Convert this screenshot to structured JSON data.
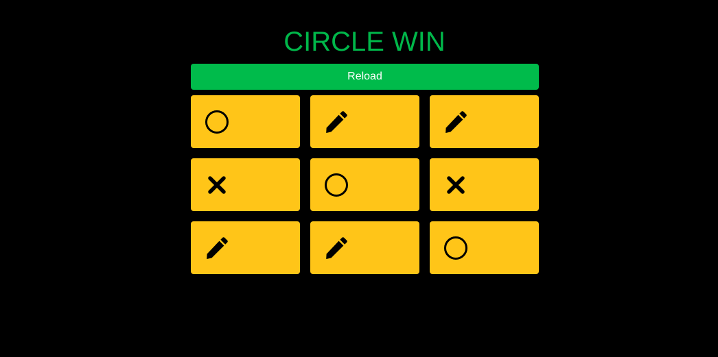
{
  "status": {
    "text": "CIRCLE WIN"
  },
  "controls": {
    "reload_label": "Reload"
  },
  "board": {
    "cells": [
      "circle-icon",
      "pencil-icon",
      "pencil-icon",
      "cross-icon",
      "circle-icon",
      "cross-icon",
      "pencil-icon",
      "pencil-icon",
      "circle-icon"
    ]
  },
  "colors": {
    "background": "#000000",
    "status_text": "#00b74a",
    "reload_button": "#00bb4b",
    "cell": "#ffc518",
    "icon": "#000000"
  }
}
